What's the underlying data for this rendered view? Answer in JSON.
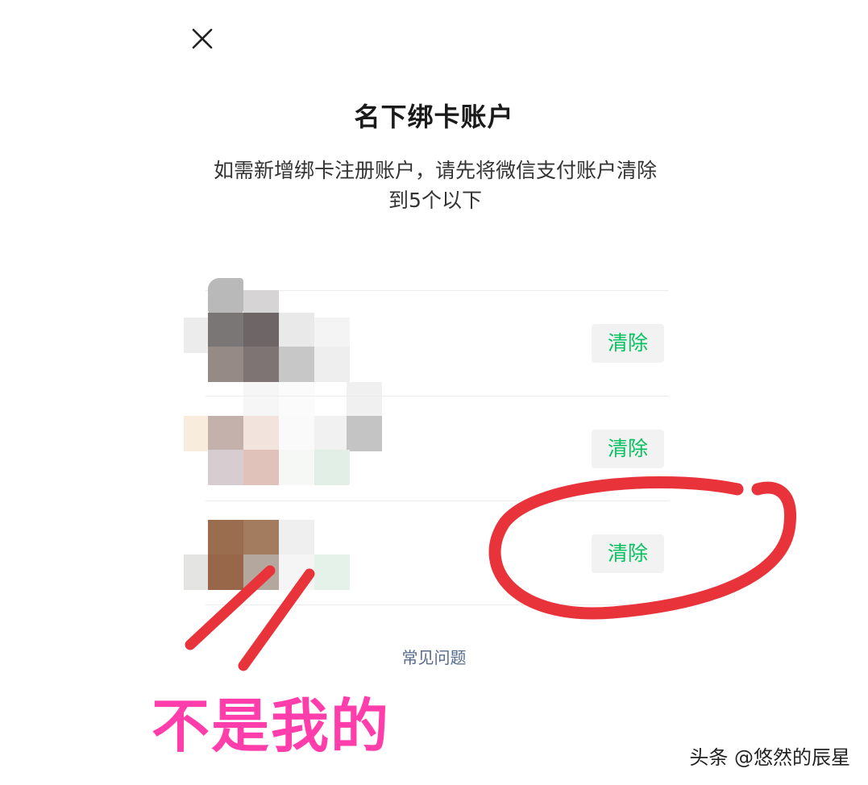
{
  "header": {
    "close_icon": "close-icon"
  },
  "title": "名下绑卡账户",
  "description": "如需新增绑卡注册账户，请先将微信支付账户清除到5个以下",
  "accounts": [
    {
      "clear_label": "清除"
    },
    {
      "clear_label": "清除"
    },
    {
      "clear_label": "清除"
    }
  ],
  "faq_link": "常见问题",
  "annotation": "不是我的",
  "watermark": "头条 @悠然的辰星",
  "colors": {
    "accent_green": "#07c160",
    "annotation_pink": "#ff3dab",
    "annotation_red": "#e8333a"
  }
}
